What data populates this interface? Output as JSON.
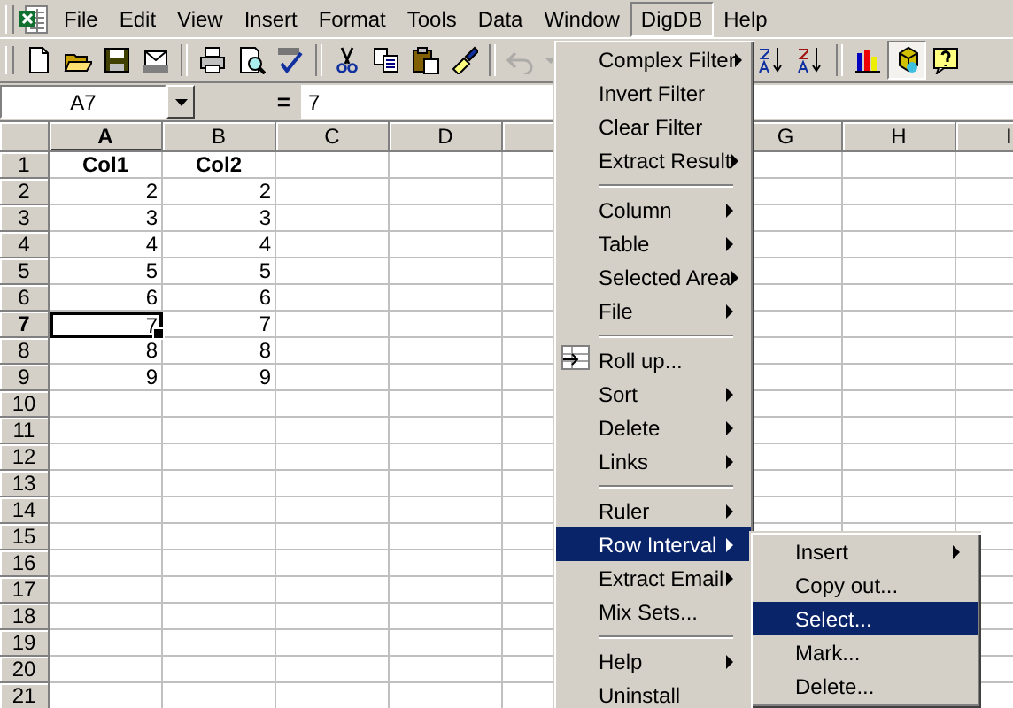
{
  "menubar": {
    "items": [
      {
        "label": "File",
        "selected": false
      },
      {
        "label": "Edit",
        "selected": false
      },
      {
        "label": "View",
        "selected": false
      },
      {
        "label": "Insert",
        "selected": false
      },
      {
        "label": "Format",
        "selected": false
      },
      {
        "label": "Tools",
        "selected": false
      },
      {
        "label": "Data",
        "selected": false
      },
      {
        "label": "Window",
        "selected": false
      },
      {
        "label": "DigDB",
        "selected": true
      },
      {
        "label": "Help",
        "selected": false
      }
    ]
  },
  "toolbar": {
    "items": [
      {
        "kind": "new",
        "pressed": false,
        "disabled": false
      },
      {
        "kind": "open",
        "pressed": false,
        "disabled": false
      },
      {
        "kind": "save",
        "pressed": false,
        "disabled": false
      },
      {
        "kind": "mail",
        "pressed": false,
        "disabled": false
      },
      {
        "kind": "separator"
      },
      {
        "kind": "print",
        "pressed": false,
        "disabled": false
      },
      {
        "kind": "preview",
        "pressed": false,
        "disabled": false
      },
      {
        "kind": "spell",
        "pressed": false,
        "disabled": false
      },
      {
        "kind": "separator"
      },
      {
        "kind": "cut",
        "pressed": false,
        "disabled": false
      },
      {
        "kind": "copy",
        "pressed": false,
        "disabled": false
      },
      {
        "kind": "paste",
        "pressed": false,
        "disabled": false
      },
      {
        "kind": "painter",
        "pressed": false,
        "disabled": false
      },
      {
        "kind": "separator"
      },
      {
        "kind": "undo",
        "pressed": false,
        "disabled": true
      },
      {
        "kind": "dropdown",
        "pressed": false,
        "disabled": true
      },
      {
        "kind": "gap"
      },
      {
        "kind": "sort_asc",
        "pressed": false,
        "disabled": false
      },
      {
        "kind": "sort_desc",
        "pressed": false,
        "disabled": false
      },
      {
        "kind": "separator"
      },
      {
        "kind": "chart",
        "pressed": false,
        "disabled": false
      },
      {
        "kind": "cube",
        "pressed": true,
        "disabled": false
      },
      {
        "kind": "help",
        "pressed": false,
        "disabled": false
      }
    ]
  },
  "formula_bar": {
    "name_box": "A7",
    "equals": "=",
    "value": "7"
  },
  "sheet": {
    "columns": [
      {
        "label": "A",
        "selected": true
      },
      {
        "label": "B",
        "selected": false
      },
      {
        "label": "C",
        "selected": false
      },
      {
        "label": "D",
        "selected": false
      },
      {
        "selected": false
      },
      {},
      {
        "label": "G",
        "selected": false
      },
      {
        "label": "H",
        "selected": false
      },
      {
        "label": "I",
        "selected": false
      }
    ],
    "rows": [
      {
        "header": "1",
        "kind": "heading",
        "selected": false,
        "cells": [
          {
            "value": "Col1",
            "selected": false
          },
          {
            "value": "Col2",
            "selected": false
          }
        ]
      },
      {
        "header": "2",
        "kind": "data",
        "selected": false,
        "cells": [
          {
            "value": "2",
            "selected": false
          },
          {
            "value": "2",
            "selected": false
          }
        ]
      },
      {
        "header": "3",
        "kind": "data",
        "selected": false,
        "cells": [
          {
            "value": "3",
            "selected": false
          },
          {
            "value": "3",
            "selected": false
          }
        ]
      },
      {
        "header": "4",
        "kind": "data",
        "selected": false,
        "cells": [
          {
            "value": "4",
            "selected": false
          },
          {
            "value": "4",
            "selected": false
          }
        ]
      },
      {
        "header": "5",
        "kind": "data",
        "selected": false,
        "cells": [
          {
            "value": "5",
            "selected": false
          },
          {
            "value": "5",
            "selected": false
          }
        ]
      },
      {
        "header": "6",
        "kind": "data",
        "selected": false,
        "cells": [
          {
            "value": "6",
            "selected": false
          },
          {
            "value": "6",
            "selected": false
          }
        ]
      },
      {
        "header": "7",
        "kind": "data",
        "selected": true,
        "cells": [
          {
            "value": "7",
            "selected": true
          },
          {
            "value": "7",
            "selected": false
          }
        ]
      },
      {
        "header": "8",
        "kind": "data",
        "selected": false,
        "cells": [
          {
            "value": "8",
            "selected": false
          },
          {
            "value": "8",
            "selected": false
          }
        ]
      },
      {
        "header": "9",
        "kind": "data",
        "selected": false,
        "cells": [
          {
            "value": "9",
            "selected": false
          },
          {
            "value": "9",
            "selected": false
          }
        ]
      },
      {
        "header": "10",
        "selected": false
      },
      {
        "header": "11",
        "selected": false
      },
      {
        "header": "12",
        "selected": false
      },
      {
        "header": "13",
        "selected": false
      },
      {
        "header": "14",
        "selected": false
      },
      {
        "header": "15",
        "selected": false
      },
      {
        "header": "16",
        "selected": false
      },
      {
        "header": "17",
        "selected": false
      },
      {
        "header": "18",
        "selected": false
      },
      {
        "header": "19",
        "selected": false
      },
      {
        "header": "20",
        "selected": false
      },
      {
        "header": "21",
        "selected": false
      }
    ]
  },
  "menu": {
    "items": [
      {
        "kind": "item",
        "label": "Complex Filter",
        "submenu": true,
        "has_icon": false,
        "selected": false
      },
      {
        "kind": "item",
        "label": "Invert Filter",
        "submenu": false,
        "has_icon": false,
        "selected": false
      },
      {
        "kind": "item",
        "label": "Clear Filter",
        "submenu": false,
        "has_icon": false,
        "selected": false
      },
      {
        "kind": "item",
        "label": "Extract Result",
        "submenu": true,
        "has_icon": false,
        "selected": false
      },
      {
        "kind": "separator"
      },
      {
        "kind": "item",
        "label": "Column",
        "submenu": true,
        "has_icon": false,
        "selected": false
      },
      {
        "kind": "item",
        "label": "Table",
        "submenu": true,
        "has_icon": false,
        "selected": false
      },
      {
        "kind": "item",
        "label": "Selected Area",
        "submenu": true,
        "has_icon": false,
        "selected": false
      },
      {
        "kind": "item",
        "label": "File",
        "submenu": true,
        "has_icon": false,
        "selected": false
      },
      {
        "kind": "separator"
      },
      {
        "kind": "item",
        "label": "Roll up...",
        "submenu": false,
        "has_icon": true,
        "selected": false
      },
      {
        "kind": "item",
        "label": "Sort",
        "submenu": true,
        "has_icon": false,
        "selected": false
      },
      {
        "kind": "item",
        "label": "Delete",
        "submenu": true,
        "has_icon": false,
        "selected": false
      },
      {
        "kind": "item",
        "label": "Links",
        "submenu": true,
        "has_icon": false,
        "selected": false
      },
      {
        "kind": "separator"
      },
      {
        "kind": "item",
        "label": "Ruler",
        "submenu": true,
        "has_icon": false,
        "selected": false
      },
      {
        "kind": "item",
        "label": "Row Interval",
        "submenu": true,
        "has_icon": false,
        "selected": true
      },
      {
        "kind": "item",
        "label": "Extract Email",
        "submenu": true,
        "has_icon": false,
        "selected": false
      },
      {
        "kind": "item",
        "label": "Mix Sets...",
        "submenu": false,
        "has_icon": false,
        "selected": false
      },
      {
        "kind": "separator"
      },
      {
        "kind": "item",
        "label": "Help",
        "submenu": true,
        "has_icon": false,
        "selected": false
      },
      {
        "kind": "item",
        "label": "Uninstall",
        "submenu": false,
        "has_icon": false,
        "selected": false
      }
    ]
  },
  "submenu": {
    "items": [
      {
        "kind": "item",
        "label": "Insert",
        "submenu": true,
        "has_icon": false,
        "selected": false
      },
      {
        "kind": "item",
        "label": "Copy out...",
        "submenu": false,
        "has_icon": false,
        "selected": false
      },
      {
        "kind": "item",
        "label": "Select...",
        "submenu": false,
        "has_icon": false,
        "selected": true
      },
      {
        "kind": "item",
        "label": "Mark...",
        "submenu": false,
        "has_icon": false,
        "selected": false
      },
      {
        "kind": "item",
        "label": "Delete...",
        "submenu": false,
        "has_icon": false,
        "selected": false
      }
    ]
  }
}
